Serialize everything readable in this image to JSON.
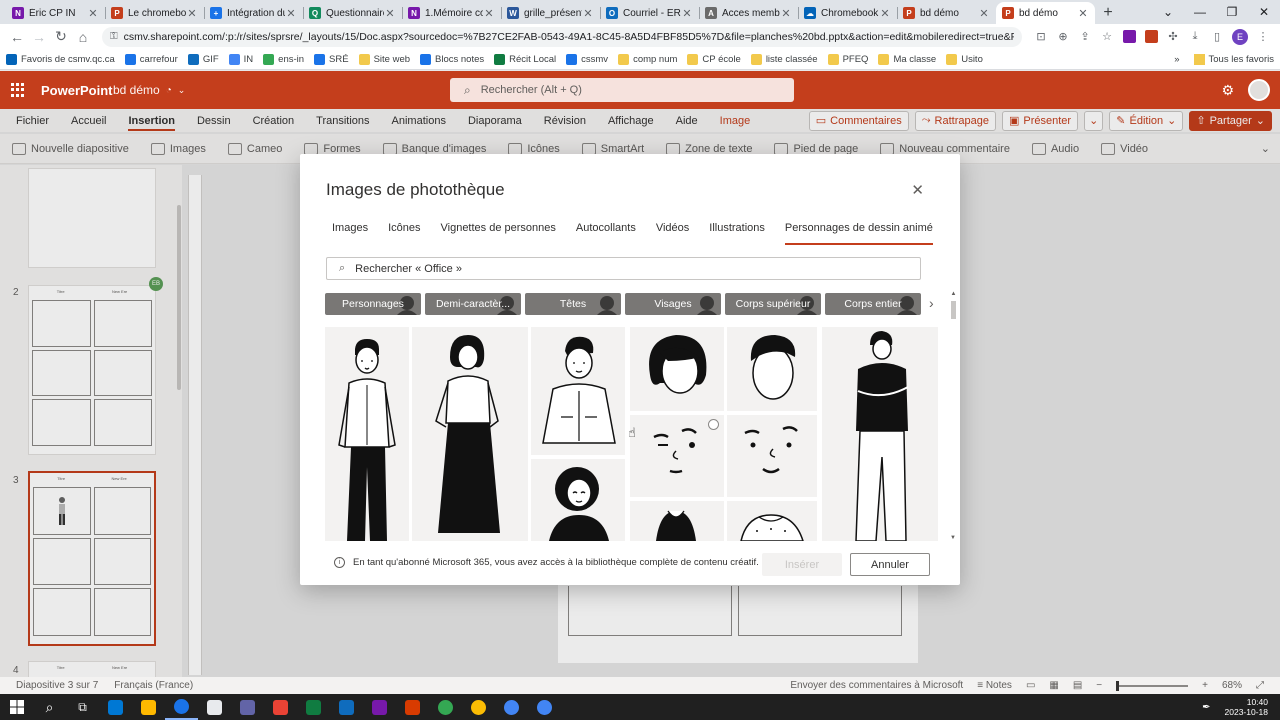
{
  "browser": {
    "tabs": [
      {
        "title": "Éric CP IN",
        "color": "#7719aa",
        "letter": "N"
      },
      {
        "title": "Le chromebook",
        "color": "#c43e1c",
        "letter": "P"
      },
      {
        "title": "Intégration du",
        "color": "#1a73e8",
        "letter": "+"
      },
      {
        "title": "Questionnaire",
        "color": "#128a5c",
        "letter": "Q"
      },
      {
        "title": "1.Mémoire coll",
        "color": "#7719aa",
        "letter": "N"
      },
      {
        "title": "grille_présentat",
        "color": "#2b579a",
        "letter": "W"
      },
      {
        "title": "Courriel - ERIC",
        "color": "#0f6cbd",
        "letter": "O"
      },
      {
        "title": "Acces membre",
        "color": "#6a6a6a",
        "letter": "A"
      },
      {
        "title": "Chromebook",
        "color": "#0364b8",
        "letter": "☁"
      },
      {
        "title": "bd démo",
        "color": "#c43e1c",
        "letter": "P"
      },
      {
        "title": "bd démo",
        "color": "#c43e1c",
        "letter": "P"
      }
    ],
    "url": "csmv.sharepoint.com/:p:/r/sites/sprsre/_layouts/15/Doc.aspx?sourcedoc=%7B27CE2FAB-0543-49A1-8C45-8A5D4FBF85D5%7D&file=planches%20bd.pptx&action=edit&mobileredirect=true&PreviousSessionID=7adc3b2a-...",
    "bookmarks": [
      "Favoris de csmv.qc.ca",
      "carrefour",
      "GIF",
      "IN",
      "ens-in",
      "SRÉ",
      "Site web",
      "Blocs notes",
      "Récit Local",
      "cssmv",
      "comp num",
      "CP école",
      "liste classée",
      "PFEQ",
      "Ma classe",
      "Usito"
    ],
    "bookmarks_right": "Tous les favoris",
    "profile_letter": "E"
  },
  "ppt": {
    "app_name": "PowerPoint",
    "doc_name": "bd démo",
    "search_placeholder": "Rechercher (Alt + Q)",
    "ribbon_tabs": [
      "Fichier",
      "Accueil",
      "Insertion",
      "Dessin",
      "Création",
      "Transitions",
      "Animations",
      "Diaporama",
      "Révision",
      "Affichage",
      "Aide",
      "Image"
    ],
    "active_tab": "Insertion",
    "right_buttons": {
      "comments": "Commentaires",
      "catchup": "Rattrapage",
      "present": "Présenter",
      "edit": "Édition",
      "share": "Partager"
    },
    "toolbar": [
      "Nouvelle diapositive",
      "Images",
      "Cameo",
      "Formes",
      "Banque d'images",
      "Icônes",
      "SmartArt",
      "Zone de texte",
      "Pied de page",
      "Nouveau commentaire",
      "Audio",
      "Vidéo"
    ],
    "thumb_labels": {
      "title": "Titre",
      "new": "New Ere"
    },
    "slide_numbers": [
      "2",
      "3",
      "4"
    ],
    "badge": "EB"
  },
  "status": {
    "slide_info": "Diapositive 3 sur 7",
    "language": "Français (France)",
    "feedback": "Envoyer des commentaires à Microsoft",
    "notes": "Notes",
    "zoom": "68%"
  },
  "taskbar": {
    "time": "10:40",
    "date": "2023-10-18",
    "apps": [
      "#0078d4",
      "#ffb900",
      "#1a73e8",
      "#e8eaed",
      "#6264a7",
      "#ea4335",
      "#107c41",
      "#0f6cbd",
      "#7719aa",
      "#d83b01",
      "#34a853",
      "#fbbc04",
      "#4285f4",
      "#4285f4"
    ]
  },
  "dialog": {
    "title": "Images de photothèque",
    "tabs": [
      "Images",
      "Icônes",
      "Vignettes de personnes",
      "Autocollants",
      "Vidéos",
      "Illustrations",
      "Personnages de dessin animé"
    ],
    "active_tab": "Personnages de dessin animé",
    "search_placeholder": "Rechercher « Office »",
    "chips": [
      "Personnages",
      "Demi-caractèr...",
      "Têtes",
      "Visages",
      "Corps supérieur",
      "Corps entier"
    ],
    "info": "En tant qu'abonné Microsoft 365, vous avez accès à la bibliothèque complète de contenu créatif.",
    "insert_label": "Insérer",
    "cancel_label": "Annuler",
    "accent": "#c43e1c"
  }
}
